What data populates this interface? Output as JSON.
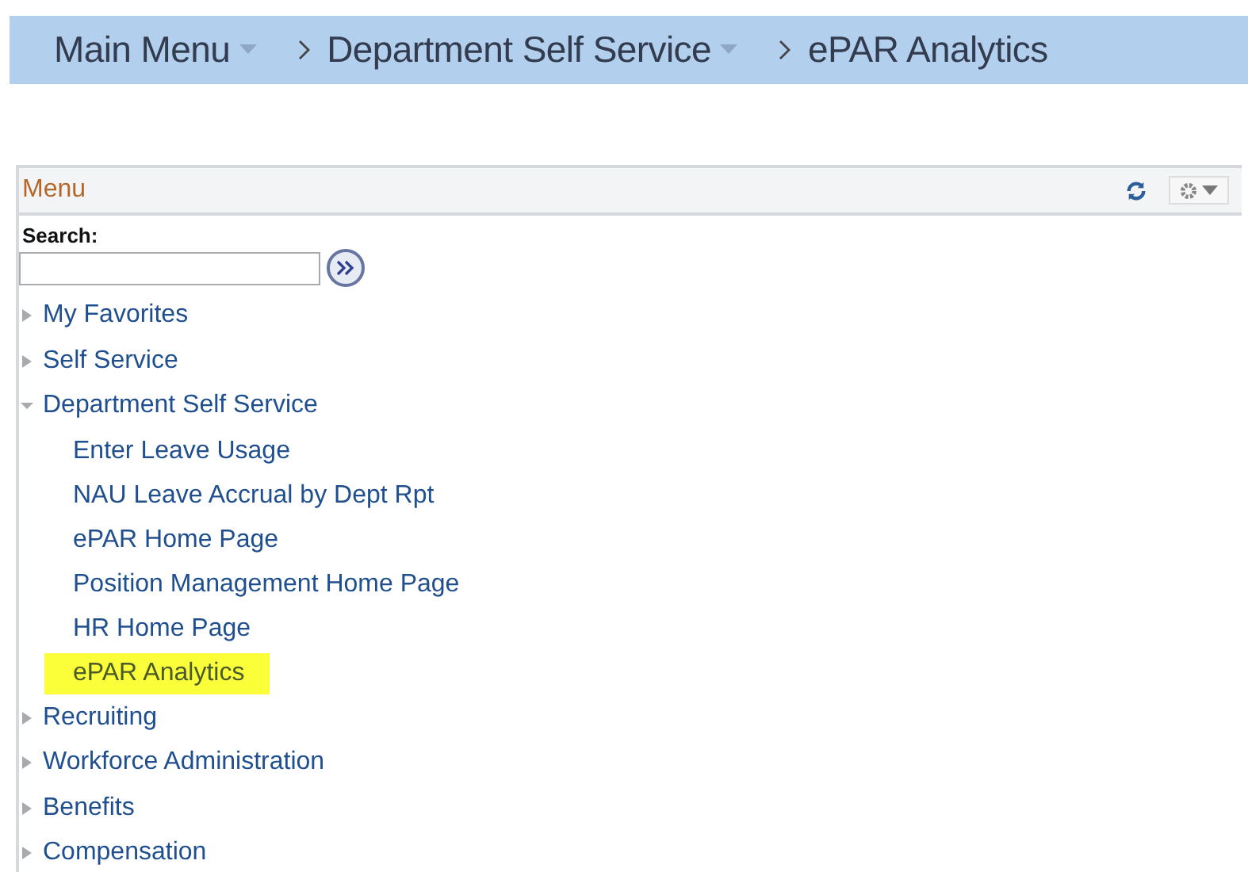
{
  "breadcrumb": [
    {
      "label": "Main Menu",
      "dropdown": true
    },
    {
      "label": "Department Self Service",
      "dropdown": true
    },
    {
      "label": "ePAR Analytics",
      "dropdown": false
    }
  ],
  "menu": {
    "title": "Menu",
    "search": {
      "label": "Search:"
    },
    "items": [
      {
        "label": "My Favorites",
        "expanded": false
      },
      {
        "label": "Self Service",
        "expanded": false
      },
      {
        "label": "Department Self Service",
        "expanded": true,
        "children": [
          {
            "label": "Enter Leave Usage",
            "selected": false
          },
          {
            "label": "NAU Leave Accrual by Dept Rpt",
            "selected": false
          },
          {
            "label": "ePAR Home Page",
            "selected": false
          },
          {
            "label": "Position Management Home Page",
            "selected": false
          },
          {
            "label": "HR Home Page",
            "selected": false
          },
          {
            "label": "ePAR Analytics",
            "selected": true
          }
        ]
      },
      {
        "label": "Recruiting",
        "expanded": false
      },
      {
        "label": "Workforce Administration",
        "expanded": false
      },
      {
        "label": "Benefits",
        "expanded": false
      },
      {
        "label": "Compensation",
        "expanded": false
      }
    ]
  }
}
